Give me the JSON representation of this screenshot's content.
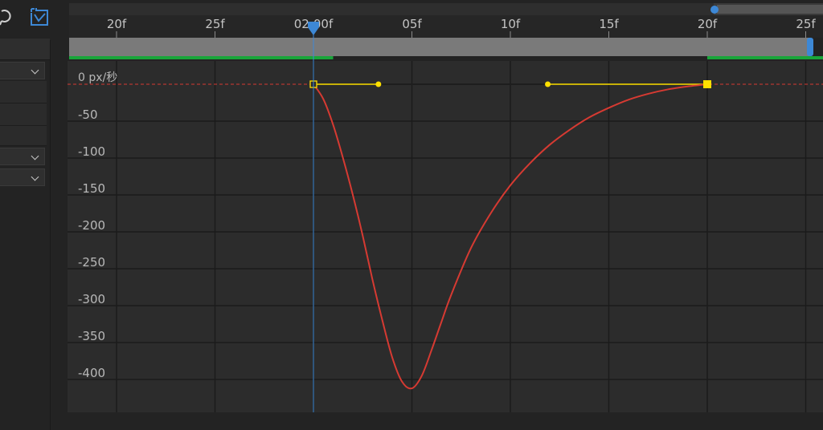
{
  "timeline": {
    "ticks": [
      "20f",
      "25f",
      "02:00f",
      "05f",
      "10f",
      "15f",
      "20f",
      "25f"
    ],
    "tick_frames": [
      -10,
      -5,
      0,
      5,
      10,
      15,
      20,
      25
    ],
    "current_frame": 0,
    "work_area_start_frame": 0,
    "work_area_end_frame": 20
  },
  "graph": {
    "unit_label": "0 px/秒",
    "y_labels": [
      "-50",
      "-100",
      "-150",
      "-200",
      "-250",
      "-300",
      "-350",
      "-400"
    ],
    "y_values": [
      -50,
      -100,
      -150,
      -200,
      -250,
      -300,
      -350,
      -400
    ],
    "speed_curve": {
      "x": [
        0,
        0.5,
        1,
        1.5,
        2,
        2.5,
        3,
        3.5,
        4,
        4.5,
        5,
        5.5,
        6,
        6.5,
        7,
        8,
        9,
        10,
        11,
        12,
        13,
        14,
        15,
        16,
        17,
        18,
        19,
        20
      ],
      "y": [
        0,
        -20,
        -55,
        -100,
        -150,
        -205,
        -265,
        -320,
        -370,
        -403,
        -412,
        -395,
        -360,
        -322,
        -285,
        -222,
        -175,
        -137,
        -107,
        -82,
        -62,
        -45,
        -32,
        -21,
        -13,
        -7,
        -3,
        0
      ]
    },
    "keyframes": [
      {
        "frame": 0,
        "value": 0,
        "style": "hollow",
        "influence_handle_frame": 3.3
      },
      {
        "frame": 20,
        "value": 0,
        "style": "filled",
        "influence_handle_frame": 11.9
      }
    ],
    "colors": {
      "curve": "#d63a32",
      "handle": "#ffe000",
      "playhead": "#3d88d6",
      "work_area": "#19a53a"
    }
  },
  "icons": {
    "graph_type": "graph-editor-icon",
    "snapshot": "snapshot-icon"
  }
}
